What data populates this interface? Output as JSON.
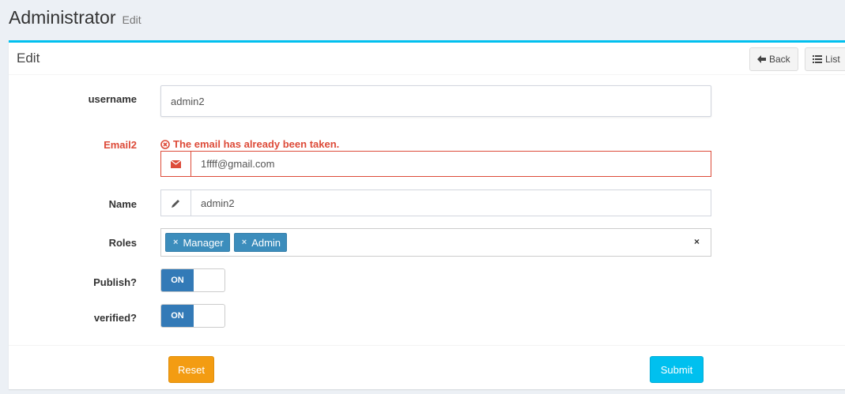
{
  "header": {
    "title": "Administrator",
    "subtitle": "Edit"
  },
  "box": {
    "title": "Edit",
    "back_label": "Back",
    "list_label": "List"
  },
  "form": {
    "username": {
      "label": "username",
      "value": "admin2"
    },
    "email": {
      "label": "Email2",
      "error": "The email has already been taken.",
      "value": "1ffff@gmail.com"
    },
    "name": {
      "label": "Name",
      "value": "admin2"
    },
    "roles": {
      "label": "Roles",
      "tags": [
        "Manager",
        "Admin"
      ],
      "clear": "×",
      "remove": "×"
    },
    "publish": {
      "label": "Publish?",
      "state": "ON"
    },
    "verified": {
      "label": "verified?",
      "state": "ON"
    }
  },
  "footer": {
    "reset_label": "Reset",
    "submit_label": "Submit"
  },
  "colors": {
    "accent": "#00c0ef",
    "error": "#dd4b39",
    "primary": "#3c8dbc",
    "warning": "#f39c12"
  }
}
